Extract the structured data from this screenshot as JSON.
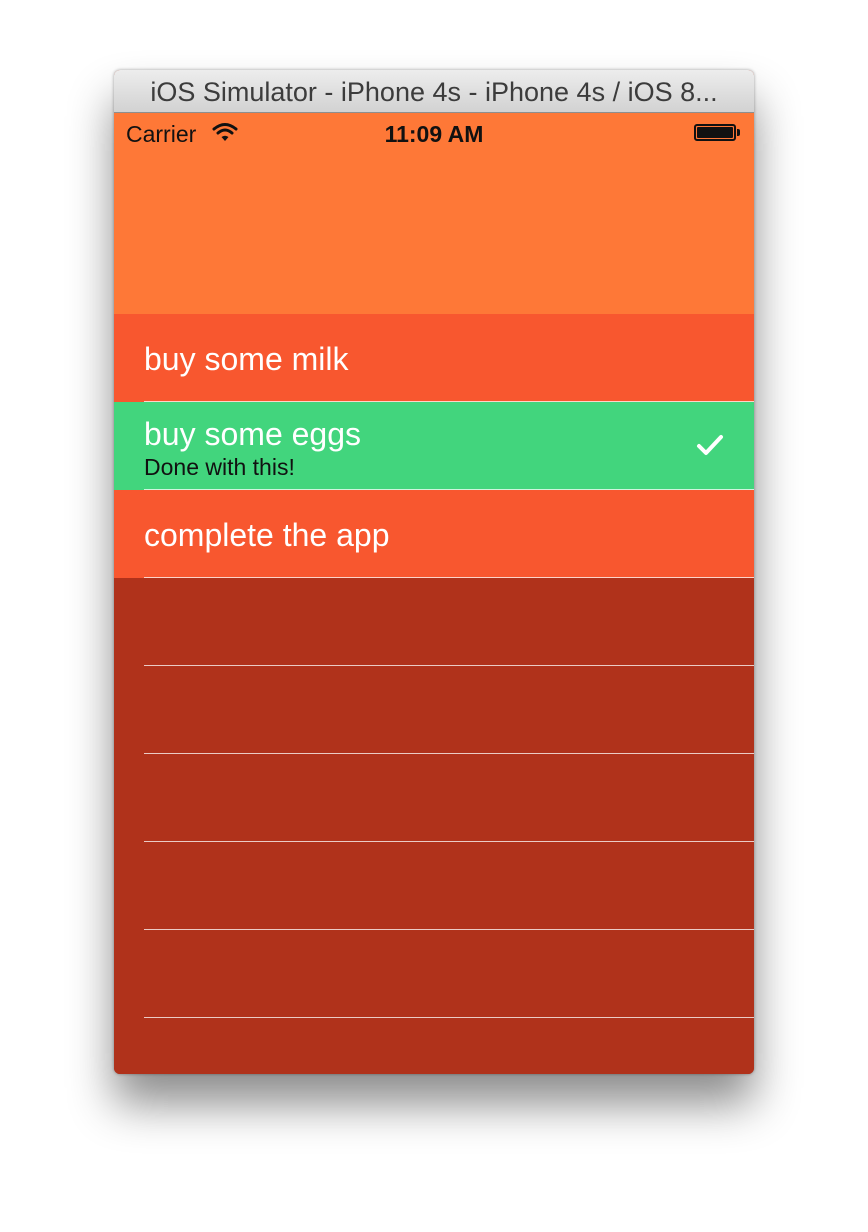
{
  "window": {
    "title": "iOS Simulator - iPhone 4s - iPhone 4s / iOS 8..."
  },
  "statusbar": {
    "carrier": "Carrier",
    "time": "11:09 AM",
    "wifi_icon": "wifi-icon",
    "battery_icon": "battery-icon"
  },
  "colors": {
    "header": "#fe7837",
    "pending_row": "#f8572f",
    "done_row": "#42d57d",
    "empty_background": "#b0321b"
  },
  "todos": [
    {
      "title": "buy some milk",
      "subtitle": "",
      "done": false
    },
    {
      "title": "buy some eggs",
      "subtitle": "Done with this!",
      "done": true,
      "accessory_icon": "checkmark-icon"
    },
    {
      "title": "complete the app",
      "subtitle": "",
      "done": false
    }
  ]
}
